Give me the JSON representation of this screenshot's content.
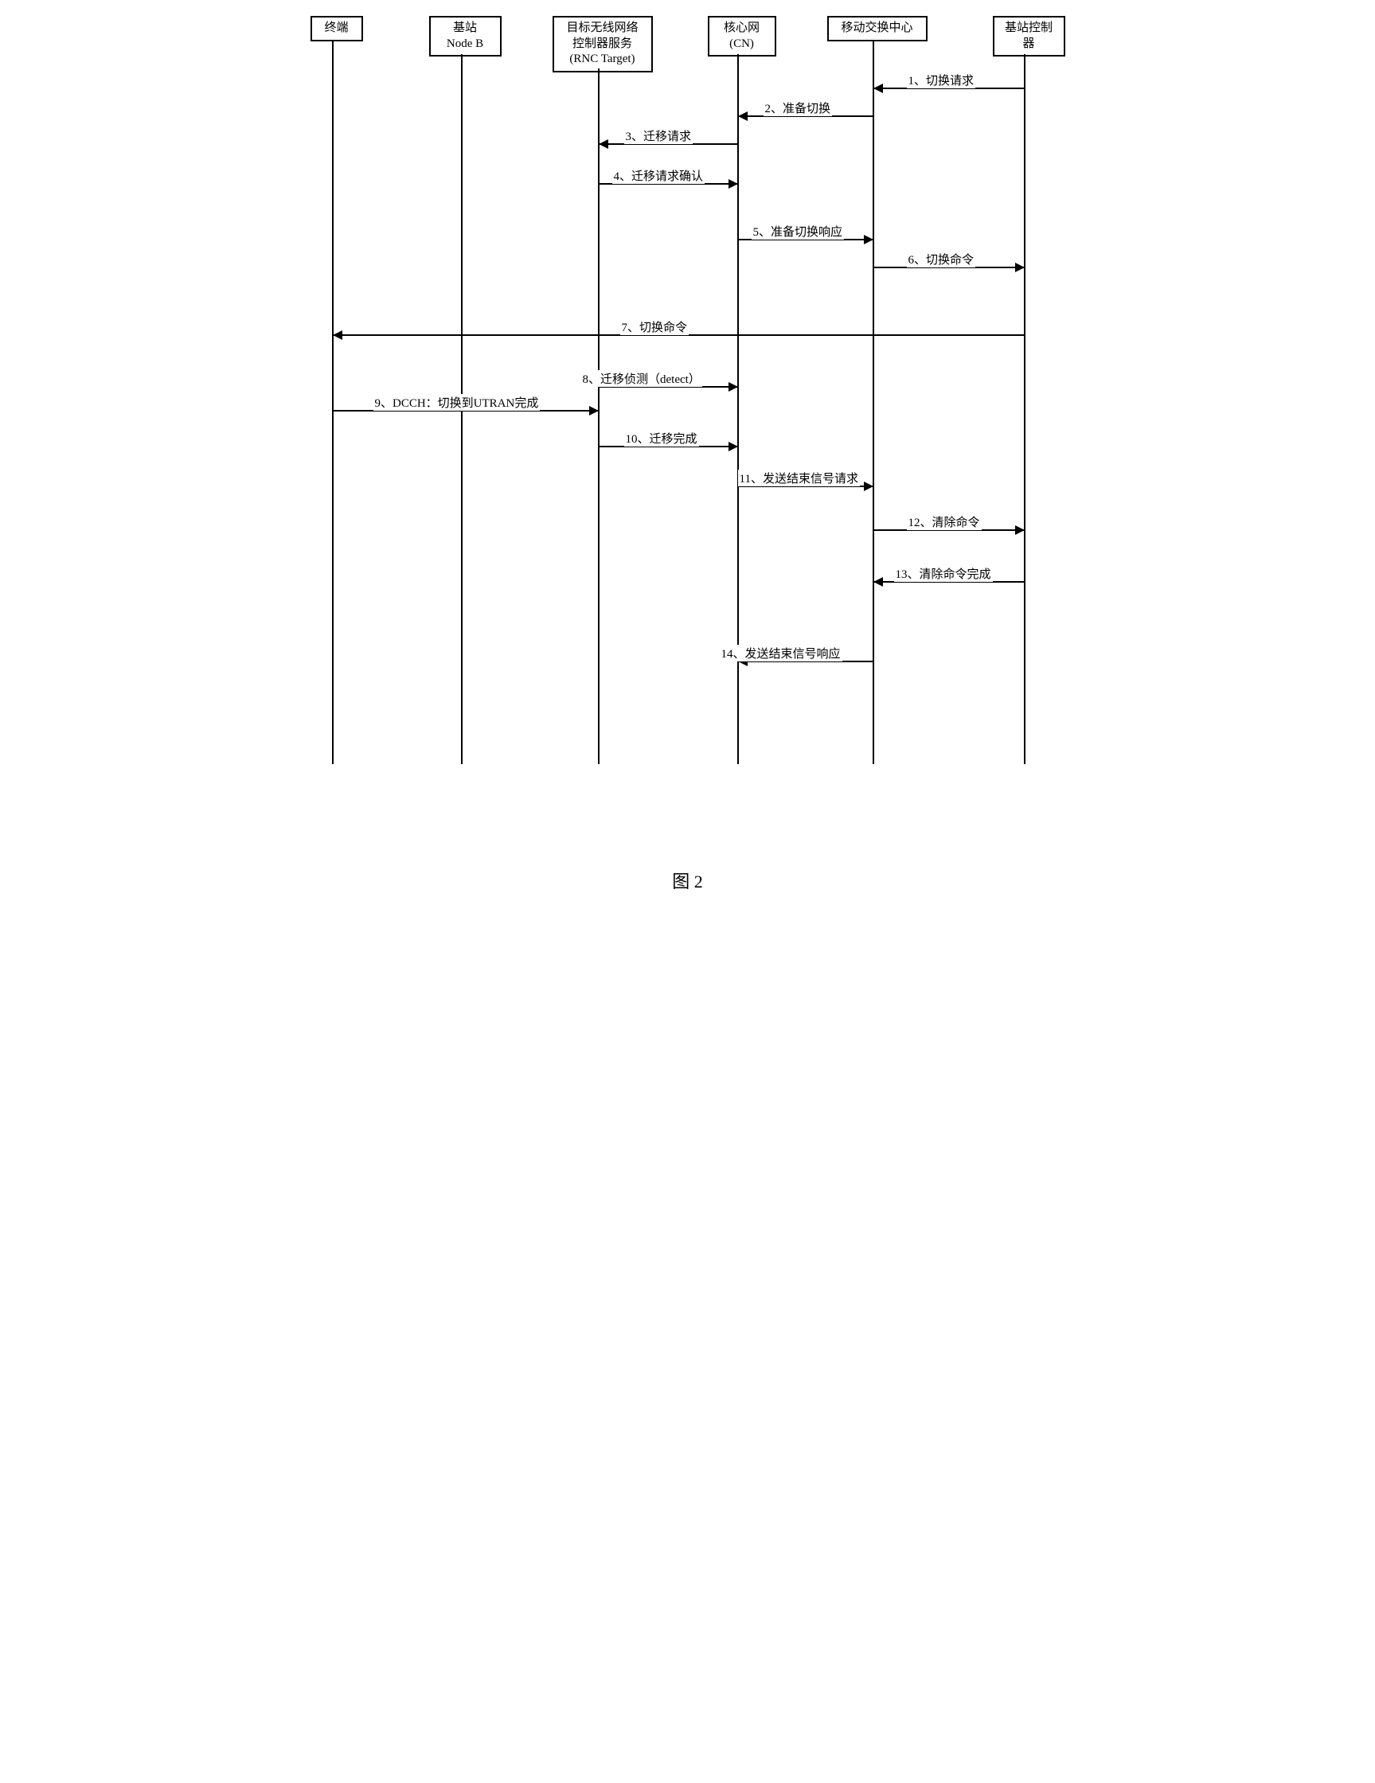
{
  "lifelines": {
    "terminal": "终端",
    "nodeb": "基站\nNode B",
    "rnc": "目标无线网络\n控制器服务\n(RNC Target)",
    "cn": "核心网\n(CN)",
    "msc": "移动交换中心",
    "bsc": "基站控制\n器"
  },
  "messages": {
    "m1": "1、切换请求",
    "m2": "2、准备切换",
    "m3": "3、迁移请求",
    "m4": "4、迁移请求确认",
    "m5": "5、准备切换响应",
    "m6": "6、切换命令",
    "m7": "7、切换命令",
    "m8": "8、迁移侦测（detect）",
    "m9": "9、DCCH：切换到UTRAN完成",
    "m10": "10、迁移完成",
    "m11": "11、发送结束信号请求",
    "m12": "12、清除命令",
    "m13": "13、清除命令完成",
    "m14": "14、发送结束信号响应"
  },
  "caption": "图 2"
}
